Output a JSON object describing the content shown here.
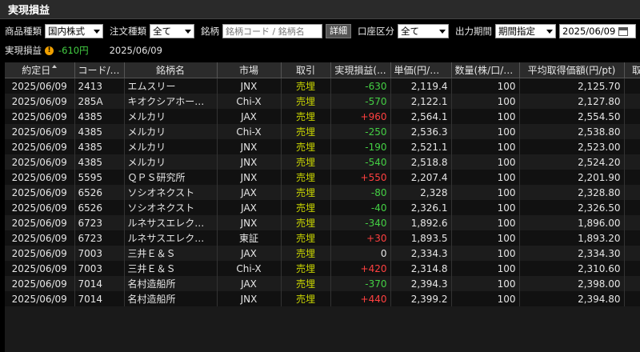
{
  "title": "実現損益",
  "filters": {
    "product_label": "商品種類",
    "product_value": "国内株式",
    "order_label": "注文種類",
    "order_value": "全て",
    "symbol_label": "銘柄",
    "symbol_placeholder": "銘柄コード / 銘柄名",
    "detail_button": "詳細",
    "account_label": "口座区分",
    "account_value": "全て",
    "period_label": "出力期間",
    "period_value": "期間指定",
    "date_value": "2025/06/09"
  },
  "summary": {
    "label": "実現損益",
    "warn_icon": "warning-icon",
    "amount": "-610円",
    "date": "2025/06/09"
  },
  "columns": [
    "約定日",
    "コード/テ...",
    "銘柄名",
    "市場",
    "取引",
    "実現損益(...",
    "単価(円/ド...",
    "数量(株/口/枚)",
    "平均取得価額(円/pt)",
    "取"
  ],
  "rows": [
    {
      "date": "2025/06/09",
      "code": "2413",
      "name": "エムスリー",
      "market": "JNX",
      "trade": "売埋",
      "pnl": "-630",
      "price": "2,119.4",
      "qty": "100",
      "avg": "2,125.70"
    },
    {
      "date": "2025/06/09",
      "code": "285A",
      "name": "キオクシアホールディ...",
      "market": "Chi-X",
      "trade": "売埋",
      "pnl": "-570",
      "price": "2,122.1",
      "qty": "100",
      "avg": "2,127.80"
    },
    {
      "date": "2025/06/09",
      "code": "4385",
      "name": "メルカリ",
      "market": "JAX",
      "trade": "売埋",
      "pnl": "+960",
      "price": "2,564.1",
      "qty": "100",
      "avg": "2,554.50"
    },
    {
      "date": "2025/06/09",
      "code": "4385",
      "name": "メルカリ",
      "market": "Chi-X",
      "trade": "売埋",
      "pnl": "-250",
      "price": "2,536.3",
      "qty": "100",
      "avg": "2,538.80"
    },
    {
      "date": "2025/06/09",
      "code": "4385",
      "name": "メルカリ",
      "market": "JNX",
      "trade": "売埋",
      "pnl": "-190",
      "price": "2,521.1",
      "qty": "100",
      "avg": "2,523.00"
    },
    {
      "date": "2025/06/09",
      "code": "4385",
      "name": "メルカリ",
      "market": "JNX",
      "trade": "売埋",
      "pnl": "-540",
      "price": "2,518.8",
      "qty": "100",
      "avg": "2,524.20"
    },
    {
      "date": "2025/06/09",
      "code": "5595",
      "name": "ＱＰＳ研究所",
      "market": "JNX",
      "trade": "売埋",
      "pnl": "+550",
      "price": "2,207.4",
      "qty": "100",
      "avg": "2,201.90"
    },
    {
      "date": "2025/06/09",
      "code": "6526",
      "name": "ソシオネクスト",
      "market": "JAX",
      "trade": "売埋",
      "pnl": "-80",
      "price": "2,328",
      "qty": "100",
      "avg": "2,328.80"
    },
    {
      "date": "2025/06/09",
      "code": "6526",
      "name": "ソシオネクスト",
      "market": "JAX",
      "trade": "売埋",
      "pnl": "-40",
      "price": "2,326.1",
      "qty": "100",
      "avg": "2,326.50"
    },
    {
      "date": "2025/06/09",
      "code": "6723",
      "name": "ルネサスエレクトロニ...",
      "market": "JNX",
      "trade": "売埋",
      "pnl": "-340",
      "price": "1,892.6",
      "qty": "100",
      "avg": "1,896.00"
    },
    {
      "date": "2025/06/09",
      "code": "6723",
      "name": "ルネサスエレクトロニ...",
      "market": "東証",
      "trade": "売埋",
      "pnl": "+30",
      "price": "1,893.5",
      "qty": "100",
      "avg": "1,893.20"
    },
    {
      "date": "2025/06/09",
      "code": "7003",
      "name": "三井Ｅ＆Ｓ",
      "market": "JAX",
      "trade": "売埋",
      "pnl": "0",
      "price": "2,334.3",
      "qty": "100",
      "avg": "2,334.30"
    },
    {
      "date": "2025/06/09",
      "code": "7003",
      "name": "三井Ｅ＆Ｓ",
      "market": "Chi-X",
      "trade": "売埋",
      "pnl": "+420",
      "price": "2,314.8",
      "qty": "100",
      "avg": "2,310.60"
    },
    {
      "date": "2025/06/09",
      "code": "7014",
      "name": "名村造船所",
      "market": "JAX",
      "trade": "売埋",
      "pnl": "-370",
      "price": "2,394.3",
      "qty": "100",
      "avg": "2,398.00"
    },
    {
      "date": "2025/06/09",
      "code": "7014",
      "name": "名村造船所",
      "market": "JNX",
      "trade": "売埋",
      "pnl": "+440",
      "price": "2,399.2",
      "qty": "100",
      "avg": "2,394.80"
    }
  ],
  "colors": {
    "positive": "#ff4040",
    "negative": "#44d044",
    "trade": "#c8d400"
  }
}
